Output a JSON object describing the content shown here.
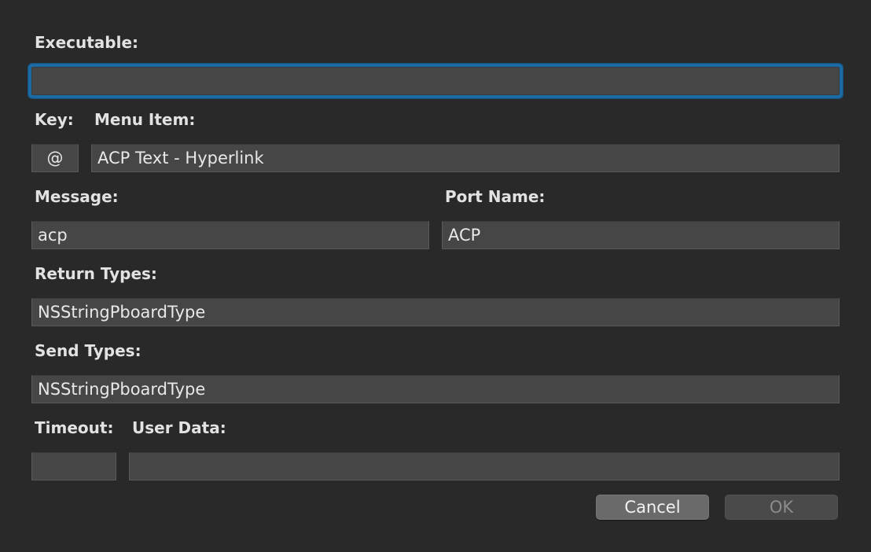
{
  "form": {
    "executable": {
      "label": "Executable:",
      "value": ""
    },
    "key": {
      "label": "Key:",
      "value": "@"
    },
    "menu_item": {
      "label": "Menu Item:",
      "value": "ACP Text - Hyperlink"
    },
    "message": {
      "label": "Message:",
      "value": "acp"
    },
    "port_name": {
      "label": "Port Name:",
      "value": "ACP"
    },
    "return_types": {
      "label": "Return Types:",
      "value": "NSStringPboardType"
    },
    "send_types": {
      "label": "Send Types:",
      "value": "NSStringPboardType"
    },
    "timeout": {
      "label": "Timeout:",
      "value": ""
    },
    "user_data": {
      "label": "User Data:",
      "value": ""
    }
  },
  "buttons": {
    "cancel_label": "Cancel",
    "ok_label": "OK"
  }
}
